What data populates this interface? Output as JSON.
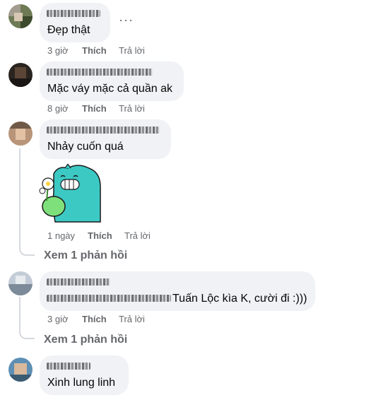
{
  "comments": [
    {
      "text": "Đẹp thật",
      "time": "3 giờ",
      "like": "Thích",
      "reply": "Trả lời",
      "avatar_icon": "user-avatar-icon",
      "more_icon": "ellipsis-icon",
      "more_glyph": "···"
    },
    {
      "text": "Mặc váy mặc cả quần ak",
      "time": "8 giờ",
      "like": "Thích",
      "reply": "Trả lời",
      "avatar_icon": "user-avatar-icon"
    },
    {
      "text": "Nhảy cuốn quá",
      "time": "1 ngày",
      "like": "Thích",
      "reply": "Trả lời",
      "view_replies": "Xem 1 phản hồi",
      "sticker_icon": "smiling-monster-holding-flower-sticker",
      "avatar_icon": "user-avatar-icon"
    },
    {
      "text": "Tuấn Lộc kìa K, cười đi :)))",
      "time": "3 giờ",
      "like": "Thích",
      "reply": "Trả lời",
      "view_replies": "Xem 1 phản hồi",
      "avatar_icon": "user-avatar-icon"
    },
    {
      "text": "Xinh lung linh",
      "avatar_icon": "user-avatar-icon"
    }
  ],
  "colors": {
    "bubble": "#f0f2f5",
    "meta_text": "#65676b",
    "body_text": "#050505",
    "sticker": "#3cc9c4"
  }
}
